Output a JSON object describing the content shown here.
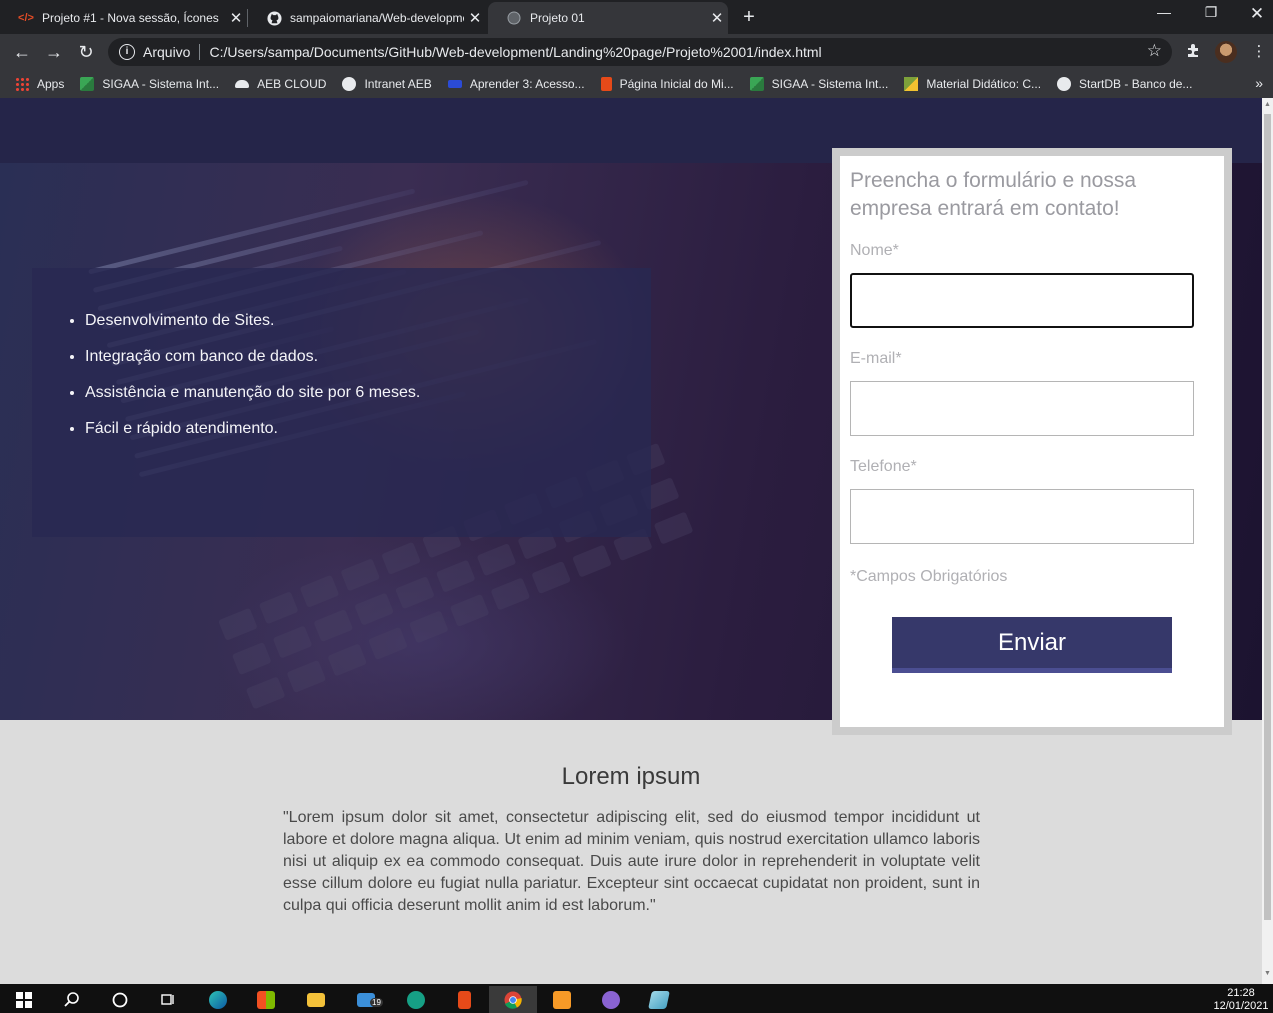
{
  "browser": {
    "tabs": [
      {
        "title": "Projeto #1 - Nova sessão, Ícones",
        "icon": "code-icon"
      },
      {
        "title": "sampaiomariana/Web-development",
        "icon": "github-icon"
      },
      {
        "title": "Projeto 01",
        "icon": "globe-icon",
        "active": true
      }
    ],
    "omnibox": {
      "scheme_label": "Arquivo",
      "url": "C:/Users/sampa/Documents/GitHub/Web-development/Landing%20page/Projeto%2001/index.html"
    },
    "bookmarks": [
      {
        "label": "Apps",
        "icon": "apps-grid-icon",
        "color": "#ea4335"
      },
      {
        "label": "SIGAA - Sistema Int...",
        "icon": "sigaa-icon",
        "color": "#3aa655"
      },
      {
        "label": "AEB CLOUD",
        "icon": "cloud-icon",
        "color": "#e8eaed"
      },
      {
        "label": "Intranet AEB",
        "icon": "globe-icon",
        "color": "#e8eaed"
      },
      {
        "label": "Aprender 3: Acesso...",
        "icon": "aprender-icon",
        "color": "#2b4bd6"
      },
      {
        "label": "Página Inicial do Mi...",
        "icon": "office-icon",
        "color": "#e64a19"
      },
      {
        "label": "SIGAA - Sistema Int...",
        "icon": "sigaa-icon",
        "color": "#3aa655"
      },
      {
        "label": "Material Didático: C...",
        "icon": "material-icon",
        "color": "#7da13a"
      },
      {
        "label": "StartDB - Banco de...",
        "icon": "globe-icon",
        "color": "#e8eaed"
      }
    ]
  },
  "page": {
    "features": [
      "Desenvolvimento de Sites.",
      "Integração com banco de dados.",
      "Assistência e manutenção do site por 6 meses.",
      "Fácil e rápido atendimento."
    ],
    "form": {
      "title": "Preencha o formulário e nossa empresa entrará em contato!",
      "name_label": "Nome*",
      "name_value": "",
      "email_label": "E-mail*",
      "email_value": "",
      "phone_label": "Telefone*",
      "phone_value": "",
      "required_note": "*Campos Obrigatórios",
      "submit_label": "Enviar"
    },
    "section": {
      "title": "Lorem ipsum",
      "text": "\"Lorem ipsum dolor sit amet, consectetur adipiscing elit, sed do eiusmod tempor incididunt ut labore et dolore magna aliqua. Ut enim ad minim veniam, quis nostrud exercitation ullamco laboris nisi ut aliquip ex ea commodo consequat. Duis aute irure dolor in reprehenderit in voluptate velit esse cillum dolore eu fugiat nulla pariatur. Excepteur sint occaecat cupidatat non proident, sunt in culpa qui officia deserunt mollit anim id est laborum.\""
    }
  },
  "taskbar": {
    "time": "21:28",
    "date": "12/01/2021",
    "mail_badge": "19"
  },
  "colors": {
    "header": "#252549",
    "button": "#36386a",
    "section_bg": "#dcdcdc"
  }
}
